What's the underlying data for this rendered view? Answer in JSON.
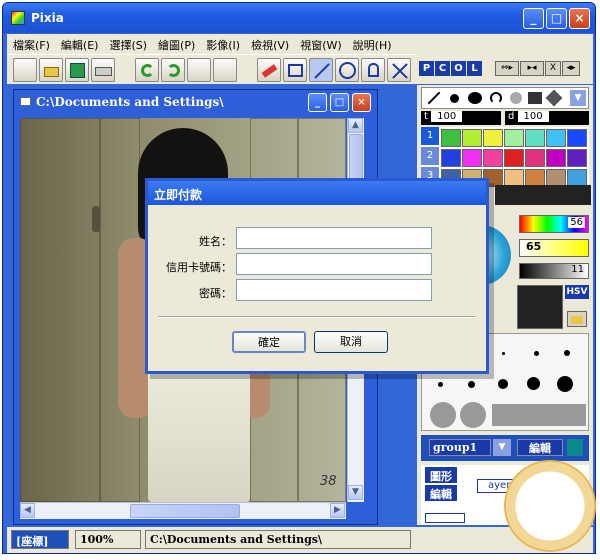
{
  "app": {
    "title": "Pixia",
    "minimize": "_",
    "maximize": "□",
    "close": "×"
  },
  "menu": [
    "檔案(F)",
    "編輯(E)",
    "選擇(S)",
    "繪圖(P)",
    "影像(I)",
    "檢視(V)",
    "視窗(W)",
    "說明(H)"
  ],
  "palette_tabs": [
    "P",
    "C",
    "O",
    "L"
  ],
  "palette_small_buttons": [
    "⇔▸",
    "▸◂",
    "X",
    "◂▸"
  ],
  "document": {
    "title": "C:\\Documents and Settings\\",
    "minimize": "_",
    "maximize": "□",
    "close": "×"
  },
  "status": {
    "coords_label": "[座標]",
    "zoom": "100%",
    "path": "C:\\Documents and Settings\\"
  },
  "dialog": {
    "title": "立即付款",
    "name_label": "姓名：",
    "card_label": "信用卡號碼：",
    "password_label": "密碼：",
    "name_value": "",
    "card_value": "",
    "password_value": "",
    "ok": "確定",
    "cancel": "取消"
  },
  "right_panel": {
    "t_label": "t",
    "t_value": "100",
    "d_label": "d",
    "d_value": "100",
    "rows": [
      "1",
      "2",
      "3"
    ],
    "num1": "56",
    "num2": "65",
    "num3": "11",
    "hsv": "HSV",
    "group": "group1",
    "edit1": "編輯",
    "shape": "圖形",
    "edit2": "編輯",
    "layer_prefix": "ayer"
  },
  "photo_label": "38",
  "colors": {
    "title_blue": "#2a5ad2",
    "face": "#ece9d8",
    "accent_red": "#c8401c"
  }
}
